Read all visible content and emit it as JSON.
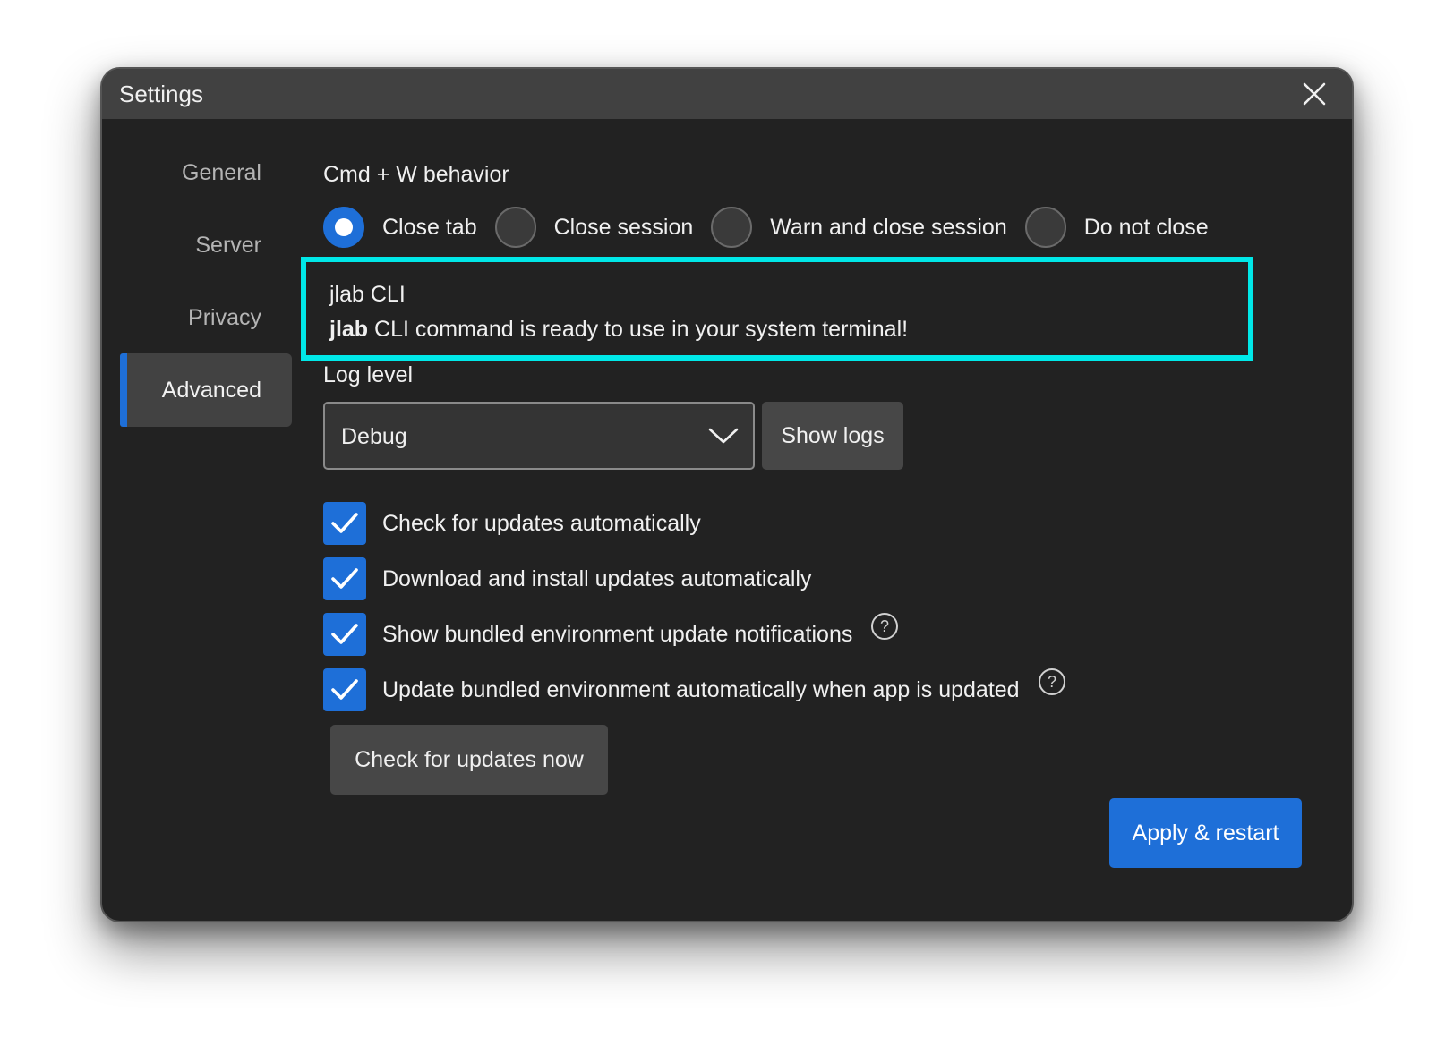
{
  "window": {
    "title": "Settings"
  },
  "sidebar": {
    "items": [
      {
        "label": "General",
        "active": false
      },
      {
        "label": "Server",
        "active": false
      },
      {
        "label": "Privacy",
        "active": false
      },
      {
        "label": "Advanced",
        "active": true
      }
    ]
  },
  "cmd_w": {
    "label": "Cmd + W behavior",
    "options": [
      {
        "label": "Close tab",
        "checked": true
      },
      {
        "label": "Close session",
        "checked": false
      },
      {
        "label": "Warn and close session",
        "checked": false
      },
      {
        "label": "Do not close",
        "checked": false
      }
    ]
  },
  "cli": {
    "title": "jlab CLI",
    "message_bold": "jlab",
    "message_rest": " CLI command is ready to use in your system terminal!"
  },
  "log_level": {
    "label": "Log level",
    "selected": "Debug",
    "show_logs_label": "Show logs"
  },
  "updates": {
    "options": [
      {
        "label": "Check for updates automatically",
        "checked": true,
        "help": false
      },
      {
        "label": "Download and install updates automatically",
        "checked": true,
        "help": false
      },
      {
        "label": "Show bundled environment update notifications",
        "checked": true,
        "help": true
      },
      {
        "label": "Update bundled environment automatically when app is updated",
        "checked": true,
        "help": true
      }
    ],
    "check_now_label": "Check for updates now"
  },
  "footer": {
    "apply_label": "Apply & restart"
  },
  "colors": {
    "accent": "#1e6fd8",
    "highlight_border": "#00e8e8",
    "window_bg": "#222222",
    "titlebar_bg": "#414141"
  },
  "icons": {
    "close": "close-icon",
    "chevron": "chevron-down-icon",
    "check": "checkmark-icon",
    "help": "help-circle-icon"
  }
}
